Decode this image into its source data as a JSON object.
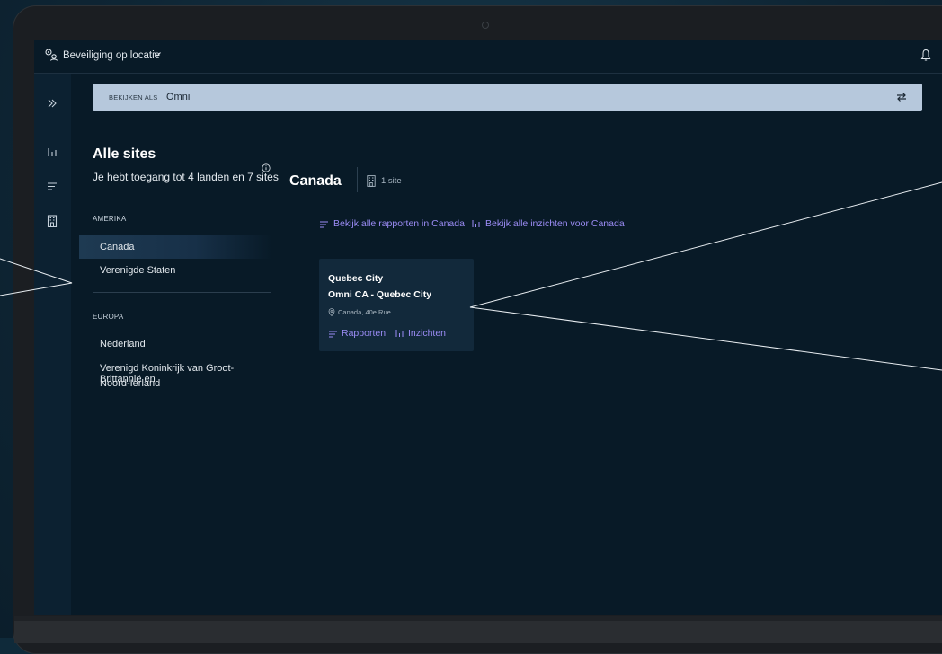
{
  "app": {
    "title": "Beveiliging op locatie"
  },
  "view_as": {
    "label": "BEKIJKEN ALS",
    "value": "Omni"
  },
  "sites": {
    "title": "Alle sites",
    "subtitle": "Je hebt toegang tot 4 landen en 7 sites"
  },
  "regions": [
    {
      "label": "AMERIKA",
      "countries": [
        "Canada",
        "Verenigde Staten"
      ]
    },
    {
      "label": "EUROPA",
      "countries": [
        "Nederland",
        "Verenigd Koninkrijk van Groot-Brittannië en",
        "Noord-Ierland"
      ]
    }
  ],
  "main": {
    "country": "Canada",
    "site_count": "1 site",
    "link_reports": "Bekijk alle rapporten in Canada",
    "link_insights": "Bekijk alle inzichten voor Canada"
  },
  "card": {
    "city": "Quebec City",
    "name": "Omni CA - Quebec City",
    "address": "Canada, 40e Rue",
    "reports": "Rapporten",
    "insights": "Inzichten"
  },
  "colors": {
    "accent": "#9b8cf5",
    "background": "#081a27",
    "view_as_bar": "#b6c8dc"
  },
  "icons": {
    "app": "location-security-icon",
    "notifications": "bell-icon",
    "rail": [
      "expand-icon",
      "insights-icon",
      "reports-icon",
      "sites-icon"
    ],
    "swap": "swap-icon"
  }
}
